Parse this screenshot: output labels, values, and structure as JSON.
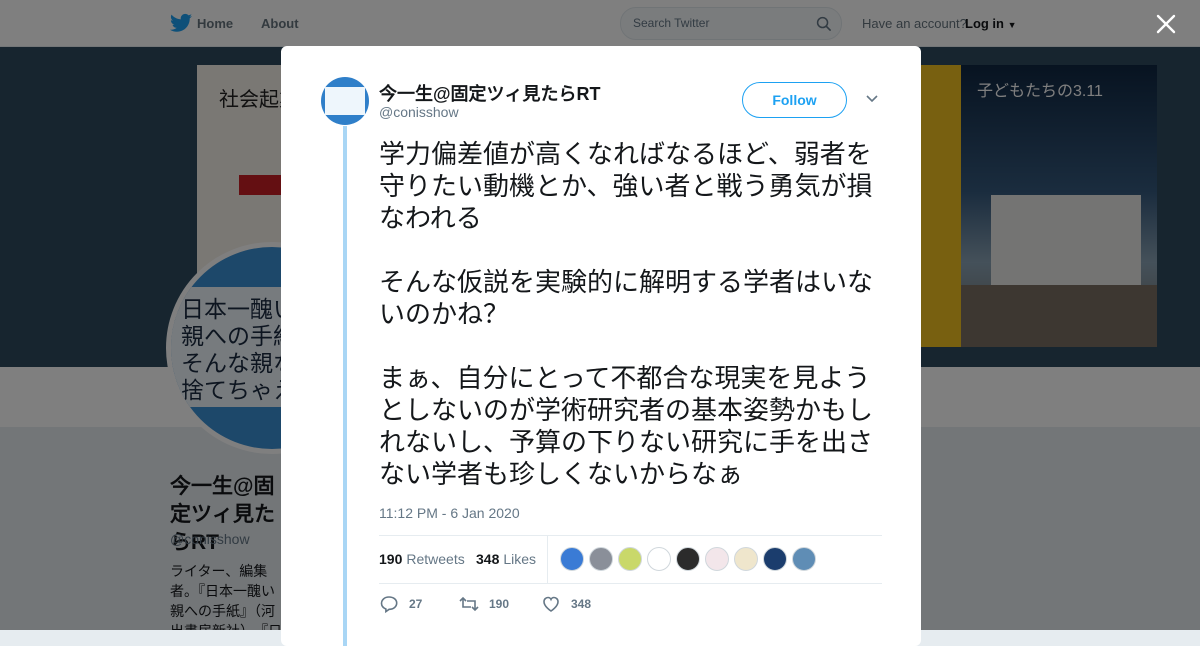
{
  "topbar": {
    "nav": [
      "Home",
      "About"
    ],
    "search_placeholder": "Search Twitter",
    "have_account": "Have an account?",
    "login": "Log in"
  },
  "banner": {
    "book1_text": "社会起業",
    "book3_text": "子どもたちの3.11"
  },
  "profile": {
    "avatar_text": "日本一醜い\n親への手紙\nそんな親な\n捨てちゃえ",
    "name": "今一生@固定ツィ見たらRT",
    "handle": "@conisshow",
    "bio": "ライター、編集者。『日本一醜い親への手紙』（河出書房新社）、『日本一醜い親へ…'てちゃえば?』（…"
  },
  "tweet": {
    "display_name": "今一生@固定ツィ見たらRT",
    "handle": "@conisshow",
    "follow_label": "Follow",
    "text": "学力偏差値が高くなればなるほど、弱者を守りたい動機とか、強い者と戦う勇気が損なわれる\n\nそんな仮説を実験的に解明する学者はいないのかね？\n\nまぁ、自分にとって不都合な現実を見ようとしないのが学術研究者の基本姿勢かもしれないし、予算の下りない研究に手を出さない学者も珍しくないからなぁ",
    "timestamp": "11:12 PM - 6 Jan 2020",
    "retweets_count": "190",
    "retweets_label": "Retweets",
    "likes_count": "348",
    "likes_label": "Likes",
    "replies": "27",
    "retweets": "190",
    "likes": "348"
  },
  "liker_colors": [
    "#3a7bd5",
    "#8a8f99",
    "#c9d86a",
    "#ffffff",
    "#2b2b2b",
    "#f3e6ea",
    "#efe6cc",
    "#1b3d6d",
    "#5f8db5"
  ],
  "colors": {
    "accent": "#1da1f2",
    "thread_line": "#a9d6f5",
    "muted": "#657786"
  }
}
